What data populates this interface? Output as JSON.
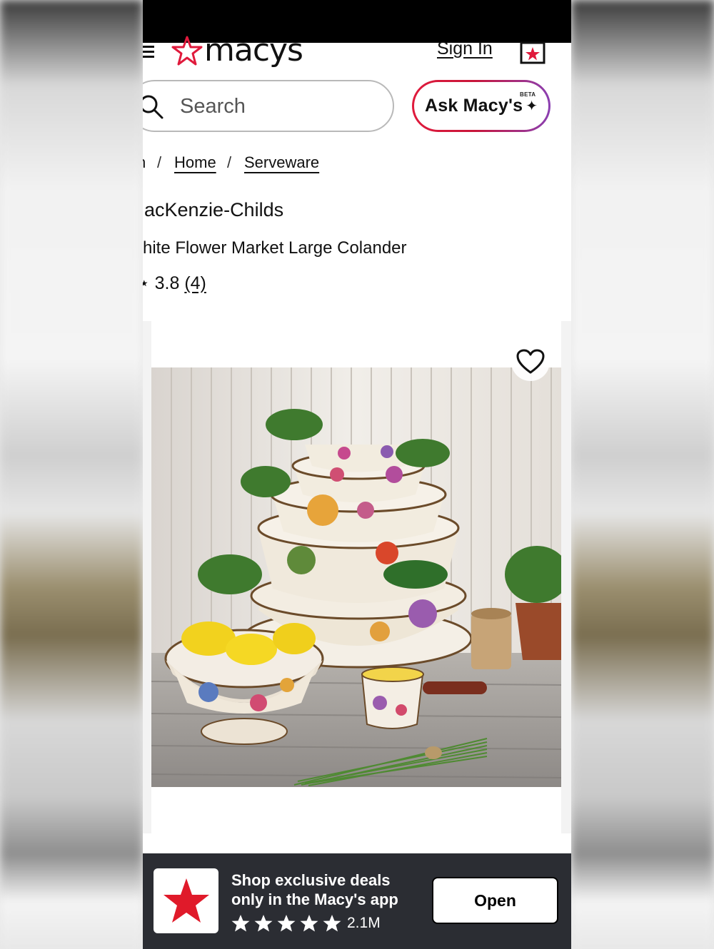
{
  "header": {
    "logo_text": "macys",
    "sign_in": "Sign In",
    "ask_label": "Ask Macy's",
    "ask_badge": "BETA"
  },
  "search": {
    "placeholder": "Search"
  },
  "breadcrumb": {
    "first_fragment": "n",
    "items": [
      "Home",
      "Serveware"
    ]
  },
  "product": {
    "brand": "acKenzie-Childs",
    "name": "hite Flower Market Large Colander",
    "rating": "3.8",
    "review_count": "(4)"
  },
  "app_banner": {
    "message": "Shop exclusive deals only in the Macy's app",
    "rating_stars": 5,
    "reviews": "2.1M",
    "open_label": "Open"
  },
  "colors": {
    "brand_red": "#e01a3c",
    "ask_gradient_end": "#8a3fb2",
    "banner_bg": "#2b2d33"
  }
}
